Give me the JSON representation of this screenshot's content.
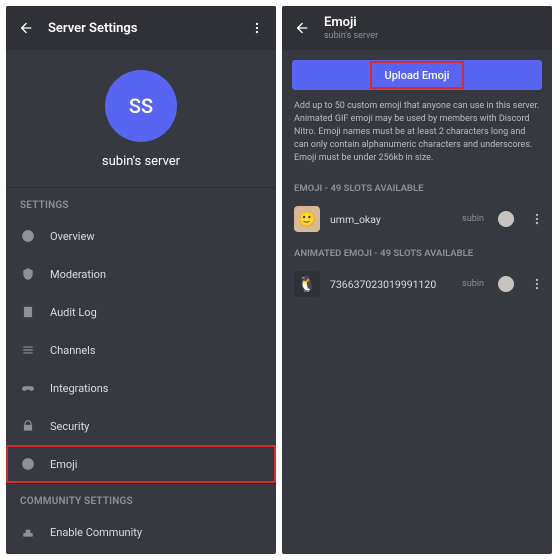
{
  "colors": {
    "accent": "#5865f2",
    "bg": "#36393f"
  },
  "left": {
    "title": "Server Settings",
    "server_initials": "SS",
    "server_name": "subin's server",
    "section_settings": "SETTINGS",
    "section_community": "COMMUNITY SETTINGS",
    "items": [
      {
        "icon": "info",
        "label": "Overview"
      },
      {
        "icon": "shield",
        "label": "Moderation"
      },
      {
        "icon": "clipboard",
        "label": "Audit Log"
      },
      {
        "icon": "channels",
        "label": "Channels"
      },
      {
        "icon": "gamepad",
        "label": "Integrations"
      },
      {
        "icon": "lock",
        "label": "Security"
      },
      {
        "icon": "emoji",
        "label": "Emoji"
      }
    ],
    "community_items": [
      {
        "icon": "community",
        "label": "Enable Community"
      }
    ]
  },
  "right": {
    "title": "Emoji",
    "subtitle": "subin's server",
    "upload_label": "Upload Emoji",
    "description": "Add up to 50 custom emoji that anyone can use in this server. Animated GIF emoji may be used by members with Discord Nitro. Emoji names must be at least 2 characters long and can only contain alphanumeric characters and underscores. Emoji must be under 256kb in size.",
    "static_head": "EMOJI - 49 SLOTS AVAILABLE",
    "animated_head": "ANIMATED EMOJI - 49 SLOTS AVAILABLE",
    "static_list": [
      {
        "name": "umm_okay",
        "uploader": "subin"
      }
    ],
    "animated_list": [
      {
        "name": "736637023019991120",
        "uploader": "subin"
      }
    ]
  }
}
